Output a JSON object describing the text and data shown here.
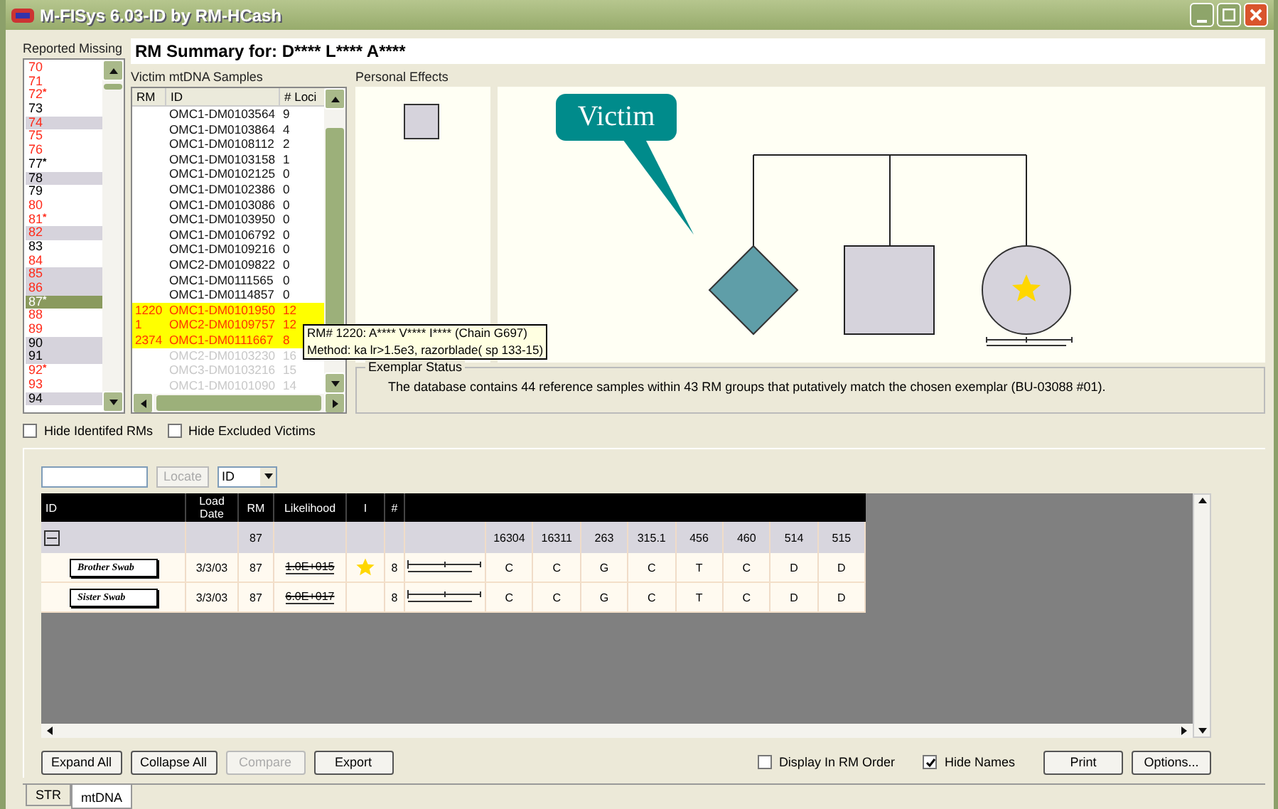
{
  "window": {
    "title": "M-FISys 6.03-ID by RM-HCash"
  },
  "missing": {
    "label": "Reported Missing",
    "items": [
      {
        "label": "70",
        "color": "#ff2a1a",
        "shaded": false,
        "selected": false
      },
      {
        "label": "71",
        "color": "#ff2a1a",
        "shaded": false,
        "selected": false
      },
      {
        "label": "72$^{*}$",
        "color": "#ff2a1a",
        "shaded": false,
        "selected": false
      },
      {
        "label": "73",
        "color": "#000000",
        "shaded": false,
        "selected": false
      },
      {
        "label": "74",
        "color": "#ff2a1a",
        "shaded": true,
        "selected": false
      },
      {
        "label": "75",
        "color": "#ff2a1a",
        "shaded": false,
        "selected": false
      },
      {
        "label": "76",
        "color": "#ff2a1a",
        "shaded": false,
        "selected": false
      },
      {
        "label": "77$^{*}$",
        "color": "#000000",
        "shaded": false,
        "selected": false
      },
      {
        "label": "78",
        "color": "#000000",
        "shaded": true,
        "selected": false
      },
      {
        "label": "79",
        "color": "#000000",
        "shaded": false,
        "selected": false
      },
      {
        "label": "80",
        "color": "#ff2a1a",
        "shaded": false,
        "selected": false
      },
      {
        "label": "81$^{*}$",
        "color": "#ff2a1a",
        "shaded": false,
        "selected": false
      },
      {
        "label": "82",
        "color": "#ff2a1a",
        "shaded": true,
        "selected": false
      },
      {
        "label": "83",
        "color": "#000000",
        "shaded": false,
        "selected": false
      },
      {
        "label": "84",
        "color": "#ff2a1a",
        "shaded": false,
        "selected": false
      },
      {
        "label": "85",
        "color": "#ff2a1a",
        "shaded": true,
        "selected": false
      },
      {
        "label": "86",
        "color": "#ff2a1a",
        "shaded": true,
        "selected": false
      },
      {
        "label": "87$^{*}$",
        "shaded": false,
        "selected": true
      },
      {
        "label": "88",
        "color": "#ff2a1a",
        "shaded": false,
        "selected": false
      },
      {
        "label": "89",
        "color": "#ff2a1a",
        "shaded": false,
        "selected": false
      },
      {
        "label": "90",
        "color": "#000000",
        "shaded": true,
        "selected": false
      },
      {
        "label": "91",
        "color": "#000000",
        "shaded": true,
        "selected": false
      },
      {
        "label": "92$^{*}$",
        "color": "#ff2a1a",
        "shaded": false,
        "selected": false
      },
      {
        "label": "93",
        "color": "#ff2a1a",
        "shaded": false,
        "selected": false
      },
      {
        "label": "94",
        "color": "#000000",
        "shaded": true,
        "selected": false
      }
    ]
  },
  "summary_title": "RM Summary for: D**** L**** A****",
  "samples": {
    "label": "Victim mtDNA Samples",
    "columns": [
      "RM",
      "ID",
      "# Loci"
    ],
    "rows": [
      {
        "kind": "normal",
        "rm": "",
        "id": "OMC1-DM0103564",
        "loci": "9"
      },
      {
        "kind": "normal",
        "rm": "",
        "id": "OMC1-DM0103864",
        "loci": "4"
      },
      {
        "kind": "normal",
        "rm": "",
        "id": "OMC1-DM0108112",
        "loci": "2"
      },
      {
        "kind": "normal",
        "rm": "",
        "id": "OMC1-DM0103158",
        "loci": "1"
      },
      {
        "kind": "normal",
        "rm": "",
        "id": "OMC1-DM0102125",
        "loci": "0"
      },
      {
        "kind": "normal",
        "rm": "",
        "id": "OMC1-DM0102386",
        "loci": "0"
      },
      {
        "kind": "normal",
        "rm": "",
        "id": "OMC1-DM0103086",
        "loci": "0"
      },
      {
        "kind": "normal",
        "rm": "",
        "id": "OMC1-DM0103950",
        "loci": "0"
      },
      {
        "kind": "normal",
        "rm": "",
        "id": "OMC1-DM0106792",
        "loci": "0"
      },
      {
        "kind": "normal",
        "rm": "",
        "id": "OMC1-DM0109216",
        "loci": "0"
      },
      {
        "kind": "normal",
        "rm": "",
        "id": "OMC2-DM0109822",
        "loci": "0"
      },
      {
        "kind": "normal",
        "rm": "",
        "id": "OMC1-DM0111565",
        "loci": "0"
      },
      {
        "kind": "normal",
        "rm": "",
        "id": "OMC1-DM0114857",
        "loci": "0"
      },
      {
        "kind": "highlighted",
        "rm": "1220",
        "id": "OMC1-DM0101950",
        "loci": "12"
      },
      {
        "kind": "highlighted",
        "rm": "1",
        "id": "OMC2-DM0109757",
        "loci": "12"
      },
      {
        "kind": "highlighted",
        "rm": "2374",
        "id": "OMC1-DM0111667",
        "loci": "8"
      },
      {
        "kind": "dimmed",
        "rm": "",
        "id": "OMC2-DM0103230",
        "loci": "16"
      },
      {
        "kind": "dimmed",
        "rm": "",
        "id": "OMC3-DM0103216",
        "loci": "15"
      },
      {
        "kind": "dimmed",
        "rm": "",
        "id": "OMC1-DM0101090",
        "loci": "14"
      }
    ]
  },
  "tooltip": [
    "RM# 1220: A**** V**** I**** (Chain G697)",
    "Method: ka lr>1.5e3,  razorblade( sp 133-15)"
  ],
  "personal_effects": {
    "label": "Personal Effects"
  },
  "pedigree": {
    "callout": "Victim"
  },
  "exemplar": {
    "label": "Exemplar Status",
    "text": "The database contains 44 reference samples within 43 RM groups that putatively match the chosen exemplar (BU-03088 #01)."
  },
  "filters": [
    {
      "label": "Hide Identifed RMs",
      "checked": false
    },
    {
      "label": "Hide Excluded Victims",
      "checked": false
    }
  ],
  "locate": {
    "button": "Locate",
    "field": "ID"
  },
  "grid": {
    "columns": [
      "ID",
      "Load Date",
      "RM",
      "Likelihood",
      "I",
      "#"
    ],
    "group": {
      "expanded": true,
      "rm": "87",
      "loci": [
        "16304",
        "16311",
        "263",
        "315.1",
        "456",
        "460",
        "514",
        "515"
      ]
    },
    "rows": [
      {
        "name": "Brother Swab",
        "date": "3/3/03",
        "rm": "87",
        "likelihood": "1.0E+015",
        "starred": true,
        "count": "8",
        "values": [
          "C",
          "C",
          "G",
          "C",
          "T",
          "C",
          "D",
          "D"
        ]
      },
      {
        "name": "Sister Swab",
        "date": "3/3/03",
        "rm": "87",
        "likelihood": "6.0E+017",
        "starred": false,
        "count": "8",
        "values": [
          "C",
          "C",
          "G",
          "C",
          "T",
          "C",
          "D",
          "D"
        ]
      }
    ]
  },
  "buttons": [
    {
      "label": "Expand All",
      "disabled": false
    },
    {
      "label": "Collapse All",
      "disabled": false
    },
    {
      "label": "Compare",
      "disabled": true
    },
    {
      "label": "Export",
      "disabled": false
    }
  ],
  "options": [
    {
      "label": "Display In RM Order",
      "checked": false
    },
    {
      "label": "Hide Names",
      "checked": true
    }
  ],
  "right_buttons": [
    "Print",
    "Options..."
  ],
  "tabs": [
    {
      "label": "STR",
      "selected": false
    },
    {
      "label": "mtDNA",
      "selected": true
    }
  ]
}
